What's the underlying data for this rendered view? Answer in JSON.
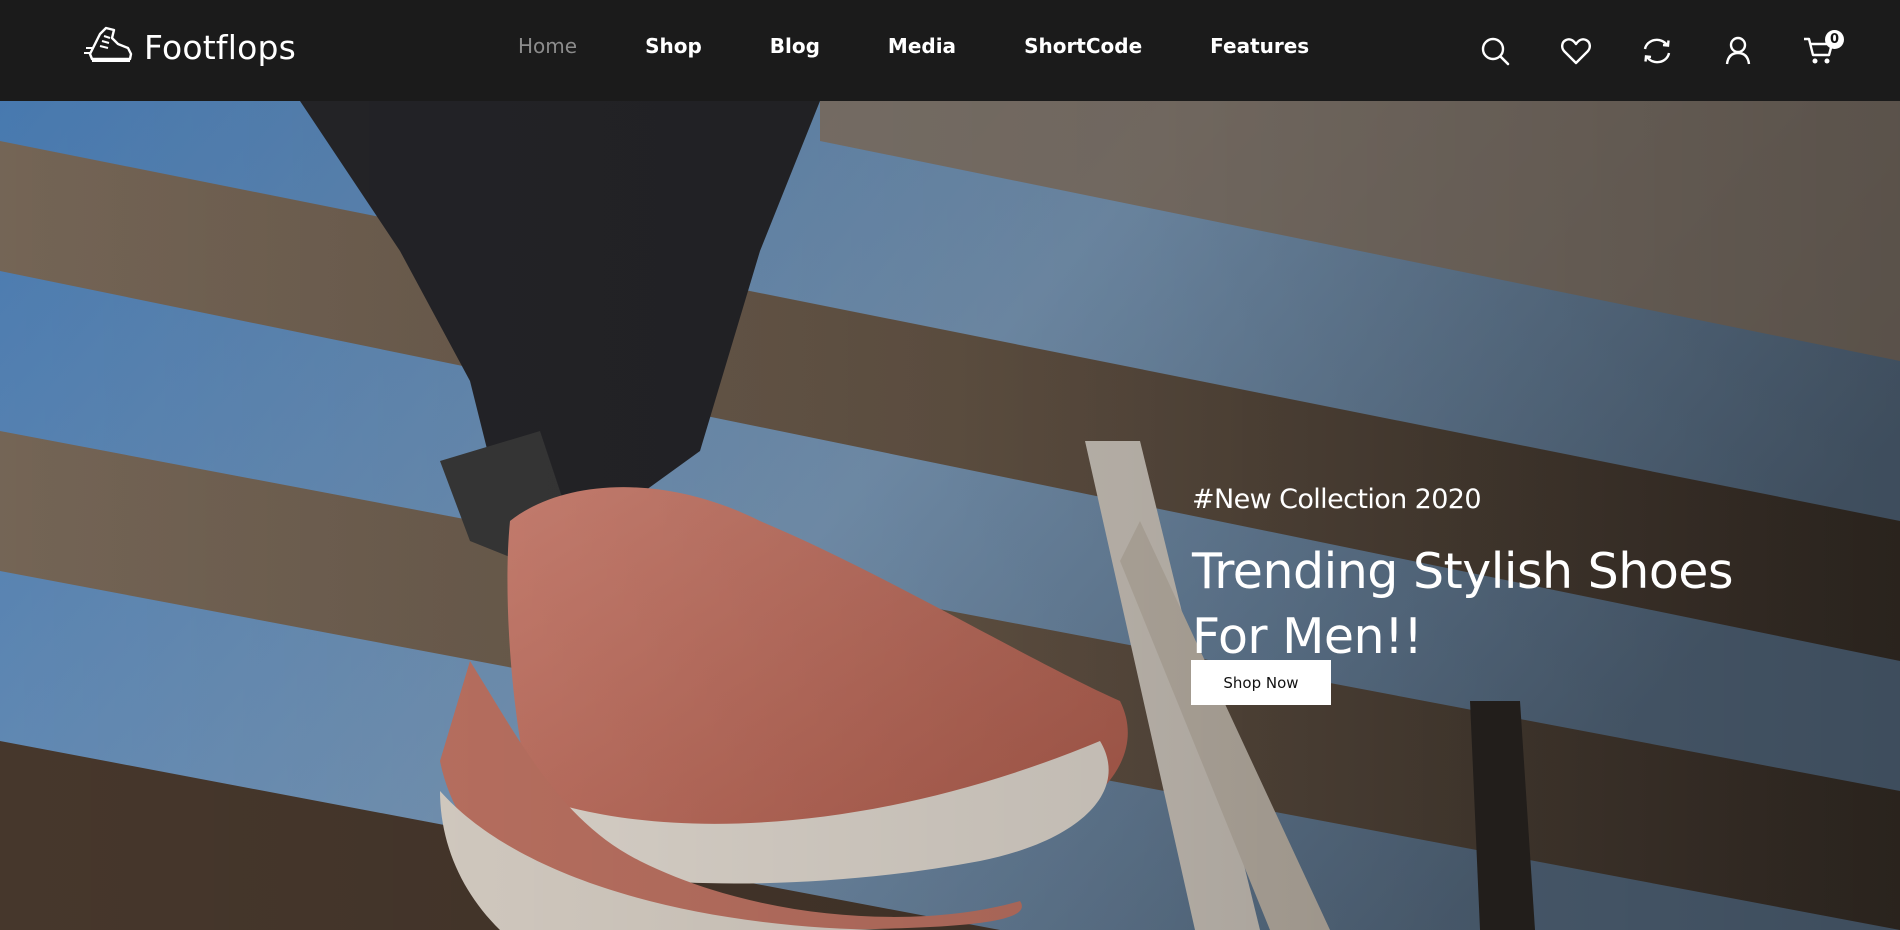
{
  "brand": {
    "name": "Footflops",
    "logo_icon": "sneaker-icon"
  },
  "nav": {
    "items": [
      {
        "label": "Home",
        "active": true
      },
      {
        "label": "Shop",
        "active": false
      },
      {
        "label": "Blog",
        "active": false
      },
      {
        "label": "Media",
        "active": false
      },
      {
        "label": "ShortCode",
        "active": false
      },
      {
        "label": "Features",
        "active": false
      }
    ]
  },
  "header_icons": {
    "search": "search-icon",
    "wishlist": "heart-icon",
    "compare": "refresh-icon",
    "account": "user-icon",
    "cart": "cart-icon",
    "cart_count": "0"
  },
  "hero": {
    "eyebrow": "#New Collection 2020",
    "headline_line1": "Trending Stylish Shoes",
    "headline_line2": "For Men!!",
    "cta_label": "Shop Now"
  },
  "colors": {
    "header_bg": "#1b1b1b",
    "nav_active": "#8c8c8c",
    "text_light": "#ffffff",
    "button_bg": "#ffffff"
  }
}
